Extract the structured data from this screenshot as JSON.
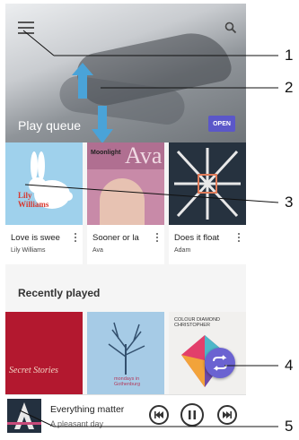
{
  "header": {
    "menu_icon": "menu-icon",
    "search_icon": "search-icon"
  },
  "play_queue": {
    "title": "Play queue",
    "open_label": "OPEN",
    "items": [
      {
        "title": "Love is swee",
        "artist": "Lily Williams",
        "art_text": "Lily Williams",
        "art_bg": "#9fd1ec"
      },
      {
        "title": "Sooner or la",
        "artist": "Ava",
        "art_text": "Ava",
        "art_sub": "Moonlight",
        "art_bg": "#c88aa8"
      },
      {
        "title": "Does it float",
        "artist": "Adam",
        "art_bg": "#26323f"
      }
    ]
  },
  "recently_played": {
    "title": "Recently played",
    "items": [
      {
        "art_text": "Secret Stories",
        "art_bg": "#b3182f"
      },
      {
        "art_text": "mondays in Gothenburg",
        "art_bg": "#a6cbe6"
      },
      {
        "art_text": "COLOUR DIAMOND CHRISTOPHER",
        "art_bg": "#f1f0ee"
      }
    ],
    "shuffle_icon": "shuffle-icon"
  },
  "mini_player": {
    "title": "Everything matter",
    "subtitle": "A pleasant day",
    "prev_icon": "previous-icon",
    "pause_icon": "pause-icon",
    "next_icon": "next-icon"
  },
  "callouts": [
    "1",
    "2",
    "3",
    "4",
    "5"
  ]
}
